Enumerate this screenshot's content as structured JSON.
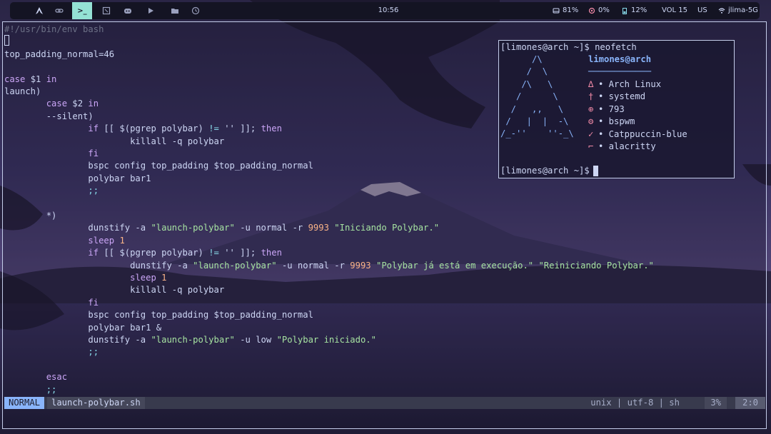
{
  "topbar": {
    "workspaces": [
      {
        "icon": "arch-icon",
        "active": false
      },
      {
        "icon": "link-icon",
        "active": false
      },
      {
        "icon": "terminal-icon",
        "active": true,
        "label": ">_"
      },
      {
        "icon": "window-icon",
        "active": false
      },
      {
        "icon": "discord-icon",
        "active": false
      },
      {
        "icon": "play-icon",
        "active": false
      },
      {
        "icon": "folder-icon",
        "active": false
      },
      {
        "icon": "clock-icon",
        "active": false
      }
    ],
    "clock": "10:56",
    "disk": "81%",
    "cpu": "0%",
    "battery": "12%",
    "volume": "VOL 15",
    "keyboard": "US",
    "wifi": "jlima-5G"
  },
  "editor": {
    "lines": [
      {
        "segments": [
          {
            "t": "#!/usr/bin/env bash",
            "c": "cm"
          }
        ]
      },
      {
        "segments": [
          {
            "t": "",
            "c": "plain"
          }
        ]
      },
      {
        "segments": [
          {
            "t": "top_padding_normal=46",
            "c": "plain"
          }
        ]
      },
      {
        "segments": [
          {
            "t": "",
            "c": "plain"
          }
        ]
      },
      {
        "segments": [
          {
            "t": "case",
            "c": "kw"
          },
          {
            "t": " $1 ",
            "c": "plain"
          },
          {
            "t": "in",
            "c": "kw"
          }
        ]
      },
      {
        "segments": [
          {
            "t": "launch)",
            "c": "plain"
          }
        ]
      },
      {
        "segments": [
          {
            "t": "        ",
            "c": "plain"
          },
          {
            "t": "case",
            "c": "kw"
          },
          {
            "t": " $2 ",
            "c": "plain"
          },
          {
            "t": "in",
            "c": "kw"
          }
        ]
      },
      {
        "segments": [
          {
            "t": "        --silent)",
            "c": "plain"
          }
        ]
      },
      {
        "segments": [
          {
            "t": "                ",
            "c": "plain"
          },
          {
            "t": "if",
            "c": "kw"
          },
          {
            "t": " [[ $(pgrep polybar) ",
            "c": "plain"
          },
          {
            "t": "!=",
            "c": "op"
          },
          {
            "t": " '' ]]; ",
            "c": "plain"
          },
          {
            "t": "then",
            "c": "kw"
          }
        ]
      },
      {
        "segments": [
          {
            "t": "                        killall -q polybar",
            "c": "plain"
          }
        ]
      },
      {
        "segments": [
          {
            "t": "                ",
            "c": "plain"
          },
          {
            "t": "fi",
            "c": "kw"
          }
        ]
      },
      {
        "segments": [
          {
            "t": "                bspc config top_padding $top_padding_normal",
            "c": "plain"
          }
        ]
      },
      {
        "segments": [
          {
            "t": "                polybar bar1",
            "c": "plain"
          }
        ]
      },
      {
        "segments": [
          {
            "t": "                ;;",
            "c": "op"
          }
        ]
      },
      {
        "segments": [
          {
            "t": "",
            "c": "plain"
          }
        ]
      },
      {
        "segments": [
          {
            "t": "        *)",
            "c": "plain"
          }
        ]
      },
      {
        "segments": [
          {
            "t": "                dunstify -a ",
            "c": "plain"
          },
          {
            "t": "\"launch-polybar\"",
            "c": "str"
          },
          {
            "t": " -u normal -r ",
            "c": "plain"
          },
          {
            "t": "9993",
            "c": "num"
          },
          {
            "t": " ",
            "c": "plain"
          },
          {
            "t": "\"Iniciando Polybar.\"",
            "c": "str"
          }
        ]
      },
      {
        "segments": [
          {
            "t": "                ",
            "c": "plain"
          },
          {
            "t": "sleep",
            "c": "kw"
          },
          {
            "t": " ",
            "c": "plain"
          },
          {
            "t": "1",
            "c": "num"
          }
        ]
      },
      {
        "segments": [
          {
            "t": "                ",
            "c": "plain"
          },
          {
            "t": "if",
            "c": "kw"
          },
          {
            "t": " [[ $(pgrep polybar) ",
            "c": "plain"
          },
          {
            "t": "!=",
            "c": "op"
          },
          {
            "t": " '' ]]; ",
            "c": "plain"
          },
          {
            "t": "then",
            "c": "kw"
          }
        ]
      },
      {
        "segments": [
          {
            "t": "                        dunstify -a ",
            "c": "plain"
          },
          {
            "t": "\"launch-polybar\"",
            "c": "str"
          },
          {
            "t": " -u normal -r ",
            "c": "plain"
          },
          {
            "t": "9993",
            "c": "num"
          },
          {
            "t": " ",
            "c": "plain"
          },
          {
            "t": "\"Polybar já está em execução.\"",
            "c": "str"
          },
          {
            "t": " ",
            "c": "plain"
          },
          {
            "t": "\"Reiniciando Polybar.\"",
            "c": "str"
          }
        ]
      },
      {
        "segments": [
          {
            "t": "                        ",
            "c": "plain"
          },
          {
            "t": "sleep",
            "c": "kw"
          },
          {
            "t": " ",
            "c": "plain"
          },
          {
            "t": "1",
            "c": "num"
          }
        ]
      },
      {
        "segments": [
          {
            "t": "                        killall -q polybar",
            "c": "plain"
          }
        ]
      },
      {
        "segments": [
          {
            "t": "                ",
            "c": "plain"
          },
          {
            "t": "fi",
            "c": "kw"
          }
        ]
      },
      {
        "segments": [
          {
            "t": "                bspc config top_padding $top_padding_normal",
            "c": "plain"
          }
        ]
      },
      {
        "segments": [
          {
            "t": "                polybar bar1 &",
            "c": "plain"
          }
        ]
      },
      {
        "segments": [
          {
            "t": "                dunstify -a ",
            "c": "plain"
          },
          {
            "t": "\"launch-polybar\"",
            "c": "str"
          },
          {
            "t": " -u low ",
            "c": "plain"
          },
          {
            "t": "\"Polybar iniciado.\"",
            "c": "str"
          }
        ]
      },
      {
        "segments": [
          {
            "t": "                ;;",
            "c": "op"
          }
        ]
      },
      {
        "segments": [
          {
            "t": "",
            "c": "plain"
          }
        ]
      },
      {
        "segments": [
          {
            "t": "        ",
            "c": "plain"
          },
          {
            "t": "esac",
            "c": "kw"
          }
        ]
      },
      {
        "segments": [
          {
            "t": "        ;;",
            "c": "op"
          }
        ]
      }
    ]
  },
  "statusline": {
    "mode": "NORMAL",
    "filename": "launch-polybar.sh",
    "fileinfo": "unix | utf-8 | sh",
    "percent": "3%",
    "position": "2:0"
  },
  "neofetch": {
    "prompt_command": "[limones@arch ~]$ neofetch",
    "user_host": "limones@arch",
    "underline": "────────────",
    "logo": [
      "      /\\",
      "     /  \\",
      "    /\\   \\",
      "   /      \\",
      "  /   ,,   \\",
      " /   |  |  -\\",
      "/_-''    ''-_\\"
    ],
    "info": [
      {
        "icon": "arch-icon",
        "text": "• Arch Linux"
      },
      {
        "icon": "init-icon",
        "text": "• systemd"
      },
      {
        "icon": "package-icon",
        "text": "• 793"
      },
      {
        "icon": "wm-icon",
        "text": "• bspwm"
      },
      {
        "icon": "theme-icon",
        "text": "• Catppuccin-blue"
      },
      {
        "icon": "terminal-icon",
        "text": "• alacritty"
      }
    ],
    "prompt_final": "[limones@arch ~]$"
  }
}
